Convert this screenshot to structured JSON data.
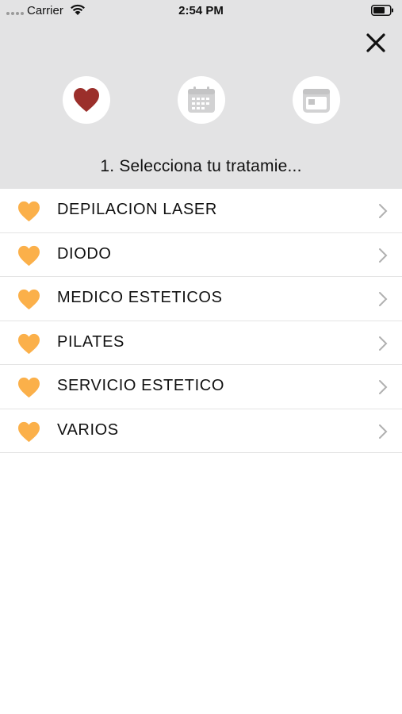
{
  "status": {
    "carrier": "Carrier",
    "time": "2:54 PM"
  },
  "steps": [
    {
      "icon": "heart-icon",
      "active": true
    },
    {
      "icon": "calendar-grid-icon",
      "active": false
    },
    {
      "icon": "calendar-day-icon",
      "active": false
    }
  ],
  "step_title": "1. Selecciona tu tratamie...",
  "treatments": [
    {
      "label": "DEPILACION LASER"
    },
    {
      "label": "DIODO"
    },
    {
      "label": "MEDICO ESTETICOS"
    },
    {
      "label": "PILATES"
    },
    {
      "label": "SERVICIO ESTETICO"
    },
    {
      "label": "VARIOS"
    }
  ],
  "colors": {
    "header_bg": "#e3e3e4",
    "active_heart": "#9b2f2b",
    "list_heart": "#fbb04a",
    "inactive_icon": "#cfcfd0",
    "chevron": "#b0b0b0"
  }
}
